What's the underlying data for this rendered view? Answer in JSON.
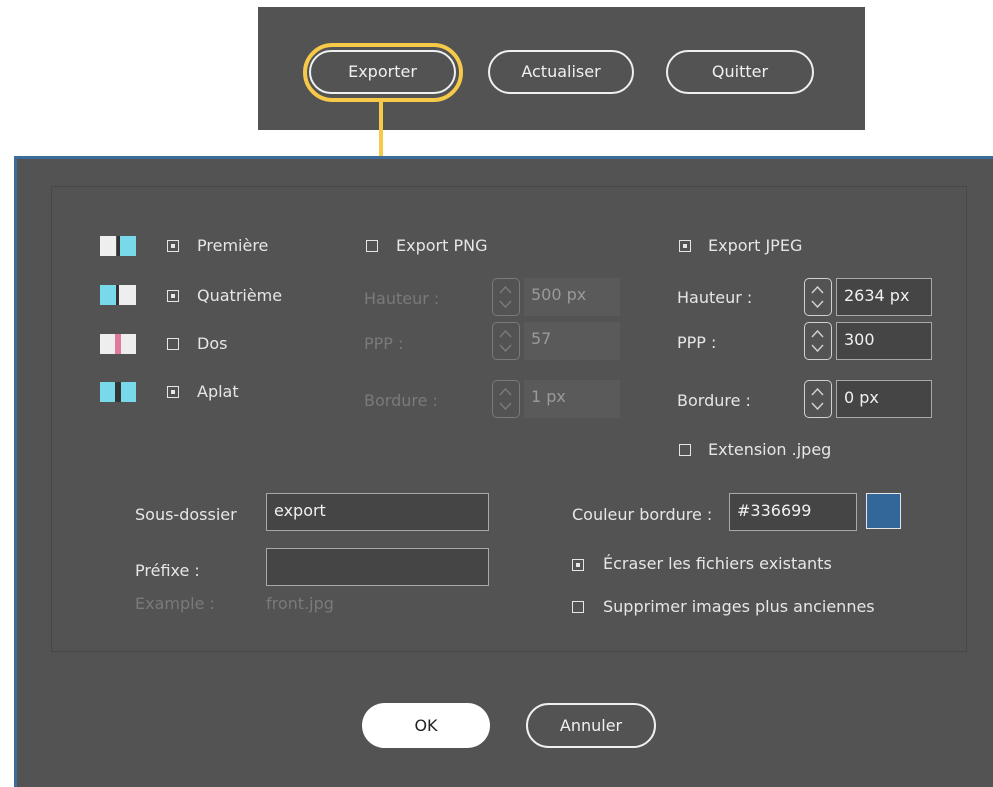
{
  "toolbar": {
    "export_label": "Exporter",
    "refresh_label": "Actualiser",
    "quit_label": "Quitter",
    "highlight_color": "#f7c948"
  },
  "pages": [
    {
      "label": "Première",
      "checked": true,
      "chip": "blue-right"
    },
    {
      "label": "Quatrième",
      "checked": true,
      "chip": "blue-left"
    },
    {
      "label": "Dos",
      "checked": false,
      "chip": "pink-middle"
    },
    {
      "label": "Aplat",
      "checked": true,
      "chip": "blue-both"
    }
  ],
  "png": {
    "label": "Export PNG",
    "checked": false,
    "height_label": "Hauteur :",
    "height_value": "500 px",
    "ppp_label": "PPP :",
    "ppp_value": "57",
    "border_label": "Bordure :",
    "border_value": "1 px"
  },
  "jpeg": {
    "label": "Export JPEG",
    "checked": true,
    "height_label": "Hauteur :",
    "height_value": "2634 px",
    "ppp_label": "PPP :",
    "ppp_value": "300",
    "border_label": "Bordure :",
    "border_value": "0 px",
    "extension_label": "Extension .jpeg",
    "extension_checked": false
  },
  "output": {
    "subfolder_label": "Sous-dossier",
    "subfolder_value": "export",
    "prefix_label": "Préfixe :",
    "prefix_value": "",
    "example_label": "Example :",
    "example_value": "front.jpg"
  },
  "options": {
    "border_color_label": "Couleur bordure :",
    "border_color_value": "#336699",
    "overwrite_label": "Écraser les fichiers existants",
    "overwrite_checked": true,
    "delete_old_label": "Supprimer images plus anciennes",
    "delete_old_checked": false
  },
  "actions": {
    "ok_label": "OK",
    "cancel_label": "Annuler"
  },
  "colors": {
    "chip_blue": "#78d9ea",
    "chip_pink": "#e07a9b",
    "chip_white": "#eeeeee",
    "dialog_bg": "#535353",
    "dialog_border": "#3d6b9a"
  }
}
